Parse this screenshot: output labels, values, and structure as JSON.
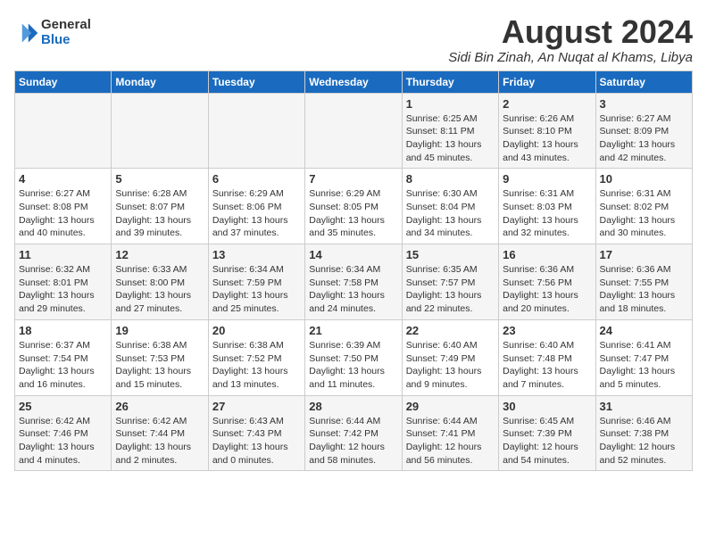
{
  "logo": {
    "line1": "General",
    "line2": "Blue"
  },
  "title": "August 2024",
  "location": "Sidi Bin Zinah, An Nuqat al Khams, Libya",
  "days_of_week": [
    "Sunday",
    "Monday",
    "Tuesday",
    "Wednesday",
    "Thursday",
    "Friday",
    "Saturday"
  ],
  "weeks": [
    [
      {
        "day": "",
        "info": ""
      },
      {
        "day": "",
        "info": ""
      },
      {
        "day": "",
        "info": ""
      },
      {
        "day": "",
        "info": ""
      },
      {
        "day": "1",
        "info": "Sunrise: 6:25 AM\nSunset: 8:11 PM\nDaylight: 13 hours\nand 45 minutes."
      },
      {
        "day": "2",
        "info": "Sunrise: 6:26 AM\nSunset: 8:10 PM\nDaylight: 13 hours\nand 43 minutes."
      },
      {
        "day": "3",
        "info": "Sunrise: 6:27 AM\nSunset: 8:09 PM\nDaylight: 13 hours\nand 42 minutes."
      }
    ],
    [
      {
        "day": "4",
        "info": "Sunrise: 6:27 AM\nSunset: 8:08 PM\nDaylight: 13 hours\nand 40 minutes."
      },
      {
        "day": "5",
        "info": "Sunrise: 6:28 AM\nSunset: 8:07 PM\nDaylight: 13 hours\nand 39 minutes."
      },
      {
        "day": "6",
        "info": "Sunrise: 6:29 AM\nSunset: 8:06 PM\nDaylight: 13 hours\nand 37 minutes."
      },
      {
        "day": "7",
        "info": "Sunrise: 6:29 AM\nSunset: 8:05 PM\nDaylight: 13 hours\nand 35 minutes."
      },
      {
        "day": "8",
        "info": "Sunrise: 6:30 AM\nSunset: 8:04 PM\nDaylight: 13 hours\nand 34 minutes."
      },
      {
        "day": "9",
        "info": "Sunrise: 6:31 AM\nSunset: 8:03 PM\nDaylight: 13 hours\nand 32 minutes."
      },
      {
        "day": "10",
        "info": "Sunrise: 6:31 AM\nSunset: 8:02 PM\nDaylight: 13 hours\nand 30 minutes."
      }
    ],
    [
      {
        "day": "11",
        "info": "Sunrise: 6:32 AM\nSunset: 8:01 PM\nDaylight: 13 hours\nand 29 minutes."
      },
      {
        "day": "12",
        "info": "Sunrise: 6:33 AM\nSunset: 8:00 PM\nDaylight: 13 hours\nand 27 minutes."
      },
      {
        "day": "13",
        "info": "Sunrise: 6:34 AM\nSunset: 7:59 PM\nDaylight: 13 hours\nand 25 minutes."
      },
      {
        "day": "14",
        "info": "Sunrise: 6:34 AM\nSunset: 7:58 PM\nDaylight: 13 hours\nand 24 minutes."
      },
      {
        "day": "15",
        "info": "Sunrise: 6:35 AM\nSunset: 7:57 PM\nDaylight: 13 hours\nand 22 minutes."
      },
      {
        "day": "16",
        "info": "Sunrise: 6:36 AM\nSunset: 7:56 PM\nDaylight: 13 hours\nand 20 minutes."
      },
      {
        "day": "17",
        "info": "Sunrise: 6:36 AM\nSunset: 7:55 PM\nDaylight: 13 hours\nand 18 minutes."
      }
    ],
    [
      {
        "day": "18",
        "info": "Sunrise: 6:37 AM\nSunset: 7:54 PM\nDaylight: 13 hours\nand 16 minutes."
      },
      {
        "day": "19",
        "info": "Sunrise: 6:38 AM\nSunset: 7:53 PM\nDaylight: 13 hours\nand 15 minutes."
      },
      {
        "day": "20",
        "info": "Sunrise: 6:38 AM\nSunset: 7:52 PM\nDaylight: 13 hours\nand 13 minutes."
      },
      {
        "day": "21",
        "info": "Sunrise: 6:39 AM\nSunset: 7:50 PM\nDaylight: 13 hours\nand 11 minutes."
      },
      {
        "day": "22",
        "info": "Sunrise: 6:40 AM\nSunset: 7:49 PM\nDaylight: 13 hours\nand 9 minutes."
      },
      {
        "day": "23",
        "info": "Sunrise: 6:40 AM\nSunset: 7:48 PM\nDaylight: 13 hours\nand 7 minutes."
      },
      {
        "day": "24",
        "info": "Sunrise: 6:41 AM\nSunset: 7:47 PM\nDaylight: 13 hours\nand 5 minutes."
      }
    ],
    [
      {
        "day": "25",
        "info": "Sunrise: 6:42 AM\nSunset: 7:46 PM\nDaylight: 13 hours\nand 4 minutes."
      },
      {
        "day": "26",
        "info": "Sunrise: 6:42 AM\nSunset: 7:44 PM\nDaylight: 13 hours\nand 2 minutes."
      },
      {
        "day": "27",
        "info": "Sunrise: 6:43 AM\nSunset: 7:43 PM\nDaylight: 13 hours\nand 0 minutes."
      },
      {
        "day": "28",
        "info": "Sunrise: 6:44 AM\nSunset: 7:42 PM\nDaylight: 12 hours\nand 58 minutes."
      },
      {
        "day": "29",
        "info": "Sunrise: 6:44 AM\nSunset: 7:41 PM\nDaylight: 12 hours\nand 56 minutes."
      },
      {
        "day": "30",
        "info": "Sunrise: 6:45 AM\nSunset: 7:39 PM\nDaylight: 12 hours\nand 54 minutes."
      },
      {
        "day": "31",
        "info": "Sunrise: 6:46 AM\nSunset: 7:38 PM\nDaylight: 12 hours\nand 52 minutes."
      }
    ]
  ]
}
